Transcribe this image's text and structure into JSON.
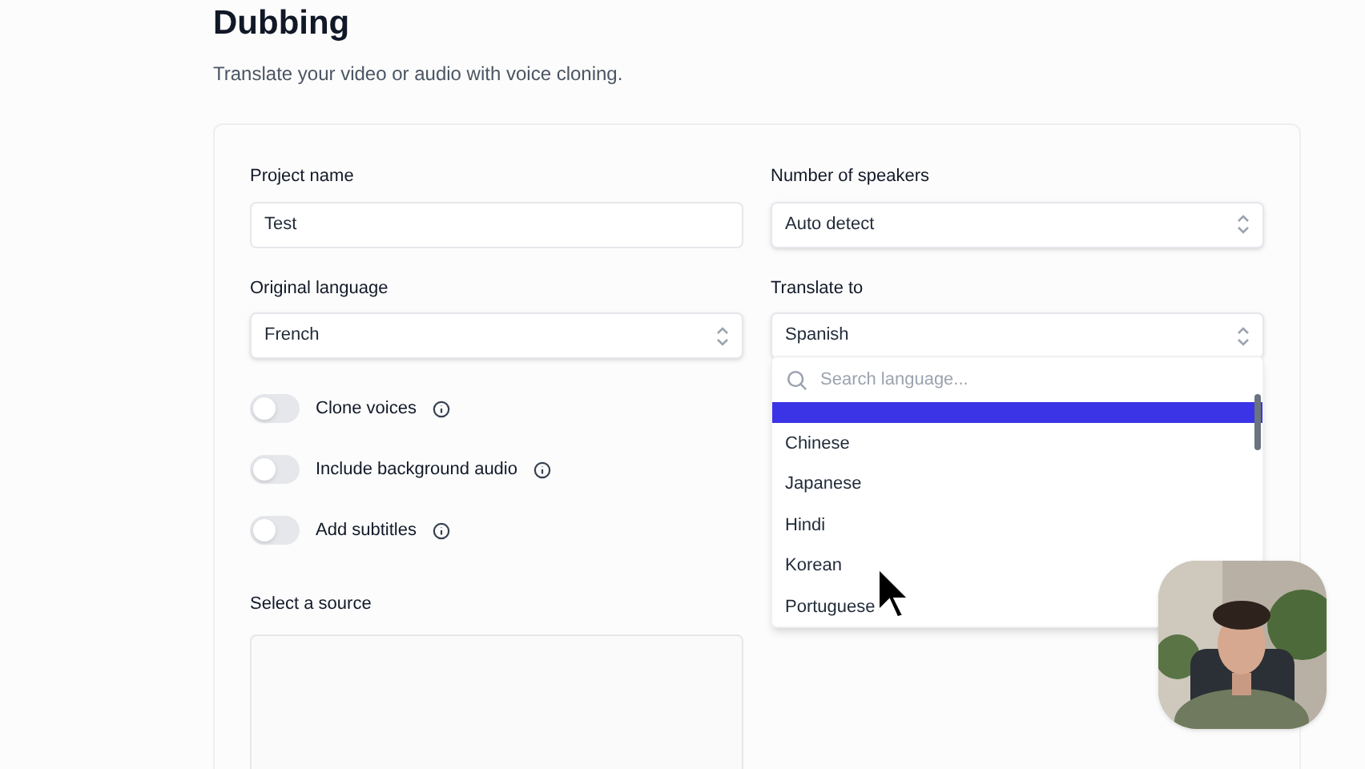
{
  "page": {
    "title": "Dubbing",
    "subtitle": "Translate your video or audio with voice cloning."
  },
  "form": {
    "project_name": {
      "label": "Project name",
      "value": "Test"
    },
    "speakers": {
      "label": "Number of speakers",
      "value": "Auto detect"
    },
    "original_language": {
      "label": "Original language",
      "value": "French"
    },
    "translate_to": {
      "label": "Translate to",
      "value": "Spanish"
    },
    "toggles": [
      {
        "label": "Clone voices",
        "on": false
      },
      {
        "label": "Include background audio",
        "on": false
      },
      {
        "label": "Add subtitles",
        "on": false
      }
    ],
    "source": {
      "label": "Select a source"
    }
  },
  "dropdown": {
    "placeholder": "Search language...",
    "options": [
      {
        "selected": true
      },
      {
        "label": "Chinese",
        "selected": false
      },
      {
        "label": "Japanese",
        "selected": false
      },
      {
        "label": "Hindi",
        "selected": false
      },
      {
        "label": "Korean",
        "selected": false
      },
      {
        "label": "Portuguese",
        "selected": false
      }
    ]
  }
}
